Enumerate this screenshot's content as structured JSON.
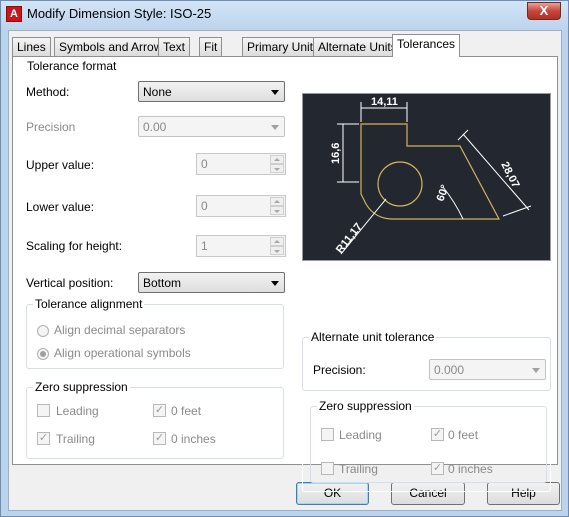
{
  "window": {
    "title": "Modify Dimension Style: ISO-25",
    "app_icon_letter": "A",
    "close_glyph": "X"
  },
  "tabs": [
    {
      "label": "Lines"
    },
    {
      "label": "Symbols and Arrows"
    },
    {
      "label": "Text"
    },
    {
      "label": "Fit"
    },
    {
      "label": "Primary Units"
    },
    {
      "label": "Alternate Units"
    },
    {
      "label": "Tolerances"
    }
  ],
  "active_tab": "Tolerances",
  "tolerance_format": {
    "title": "Tolerance format",
    "method_label": "Method:",
    "method_value": "None",
    "precision_label": "Precision",
    "precision_value": "0.00",
    "upper_label": "Upper value:",
    "upper_value": "0",
    "lower_label": "Lower value:",
    "lower_value": "0",
    "scaling_label": "Scaling for height:",
    "scaling_value": "1",
    "vertical_label": "Vertical position:",
    "vertical_value": "Bottom"
  },
  "tolerance_alignment": {
    "title": "Tolerance alignment",
    "option1": "Align decimal separators",
    "option2": "Align operational symbols",
    "selected": "Align operational symbols"
  },
  "zero_suppression_left": {
    "title": "Zero suppression",
    "leading": "Leading",
    "trailing": "Trailing",
    "zero_feet": "0 feet",
    "zero_inches": "0 inches",
    "checked": {
      "leading": false,
      "trailing": true,
      "zero_feet": true,
      "zero_inches": true
    }
  },
  "alternate_unit_tolerance": {
    "title": "Alternate unit tolerance",
    "precision_label": "Precision:",
    "precision_value": "0.000"
  },
  "zero_suppression_right": {
    "title": "Zero suppression",
    "leading": "Leading",
    "trailing": "Trailing",
    "zero_feet": "0 feet",
    "zero_inches": "0 inches",
    "checked": {
      "leading": false,
      "trailing": false,
      "zero_feet": true,
      "zero_inches": true
    }
  },
  "preview": {
    "dim_top": "14,11",
    "dim_left": "16,6",
    "dim_right": "28,07",
    "dim_angle": "60°",
    "dim_radius": "R11,17",
    "colors": {
      "background": "#232830",
      "geometry": "#d4b25a",
      "dimension": "#ffffff"
    }
  },
  "buttons": {
    "ok": "OK",
    "cancel": "Cancel",
    "help": "Help"
  },
  "check_glyph": "✓"
}
